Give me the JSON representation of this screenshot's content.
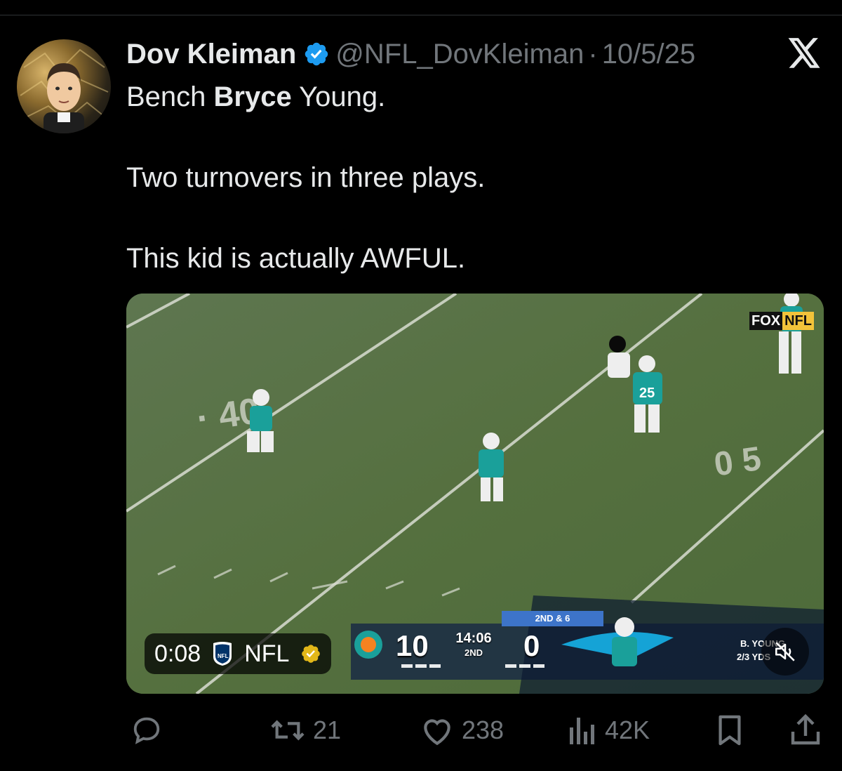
{
  "tweet": {
    "author_name": "Dov Kleiman",
    "handle": "@NFL_DovKleiman",
    "separator": "·",
    "date": "10/5/25",
    "text_line1_pre": "Bench ",
    "text_line1_bold": "Bryce",
    "text_line1_post": " Young.",
    "text_line2": "Two turnovers in three plays.",
    "text_line3": "This kid is actually AWFUL."
  },
  "video": {
    "timestamp": "0:08",
    "channel": "NFL",
    "network_logo_fox": "FOX",
    "network_logo_nfl": "NFL",
    "home_score": "10",
    "away_score": "0",
    "game_clock": "14:06",
    "quarter": "2ND",
    "down_distance": "2ND & 6",
    "player_graphic_name": "B. YOUNG",
    "player_graphic_stat": "2/3 YDS"
  },
  "actions": {
    "reply_count": "",
    "retweet_count": "21",
    "like_count": "238",
    "views_count": "42K"
  },
  "colors": {
    "background": "#000000",
    "text": "#e7e9ea",
    "muted": "#71767b",
    "verified_blue": "#1d9bf0",
    "field_green": "#566d48"
  },
  "icons": [
    "x-logo-icon",
    "verified-badge-icon",
    "reply-icon",
    "retweet-icon",
    "like-icon",
    "views-icon",
    "bookmark-icon",
    "share-icon",
    "mute-icon",
    "nfl-shield-icon"
  ]
}
